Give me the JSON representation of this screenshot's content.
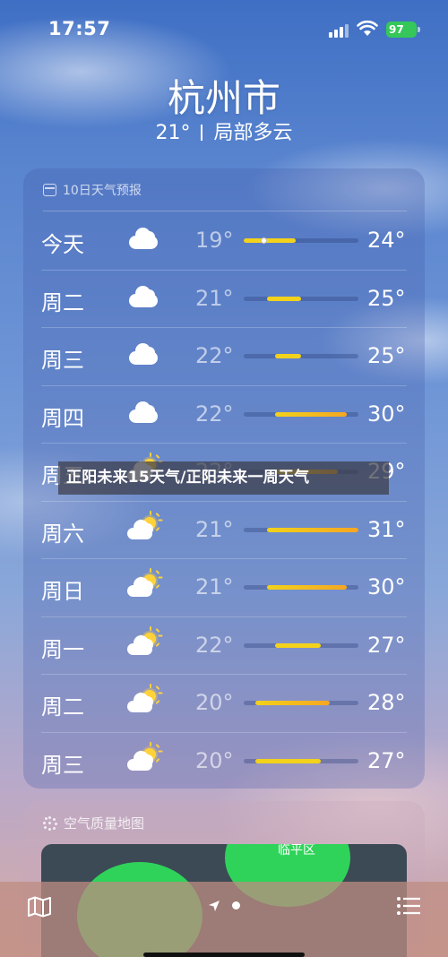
{
  "status_bar": {
    "time": "17:57",
    "battery": "97"
  },
  "header": {
    "city": "杭州市",
    "current_temp": "21°",
    "condition": "局部多云"
  },
  "forecast": {
    "title": "10日天气预报",
    "days": [
      {
        "day": "今天",
        "icon": "cloud-icon",
        "low": "19°",
        "high": "24°",
        "range_start": 0.0,
        "range_end": 0.45,
        "current_marker": 0.17
      },
      {
        "day": "周二",
        "icon": "cloud-icon",
        "low": "21°",
        "high": "25°",
        "range_start": 0.2,
        "range_end": 0.5
      },
      {
        "day": "周三",
        "icon": "cloud-icon",
        "low": "22°",
        "high": "25°",
        "range_start": 0.27,
        "range_end": 0.5
      },
      {
        "day": "周四",
        "icon": "cloud-icon",
        "low": "22°",
        "high": "30°",
        "range_start": 0.27,
        "range_end": 0.9
      },
      {
        "day": "周五",
        "icon": "partly-sunny-icon",
        "low": "22°",
        "high": "29°",
        "range_start": 0.27,
        "range_end": 0.82
      },
      {
        "day": "周六",
        "icon": "partly-sunny-icon",
        "low": "21°",
        "high": "31°",
        "range_start": 0.2,
        "range_end": 1.0
      },
      {
        "day": "周日",
        "icon": "partly-sunny-icon",
        "low": "21°",
        "high": "30°",
        "range_start": 0.2,
        "range_end": 0.9
      },
      {
        "day": "周一",
        "icon": "partly-sunny-icon",
        "low": "22°",
        "high": "27°",
        "range_start": 0.27,
        "range_end": 0.67
      },
      {
        "day": "周二",
        "icon": "partly-sunny-icon",
        "low": "20°",
        "high": "28°",
        "range_start": 0.1,
        "range_end": 0.75
      },
      {
        "day": "周三",
        "icon": "partly-sunny-icon",
        "low": "20°",
        "high": "27°",
        "range_start": 0.1,
        "range_end": 0.67
      }
    ]
  },
  "overlay": {
    "text": "正阳未来15天气/正阳未来一周天气"
  },
  "air_quality": {
    "title": "空气质量地图",
    "map_label": "临平区"
  },
  "colors": {
    "accent_warm": "#f5a623",
    "accent_yellow": "#f2d21b",
    "battery": "#35c759",
    "aq_good": "#2fd35a"
  }
}
